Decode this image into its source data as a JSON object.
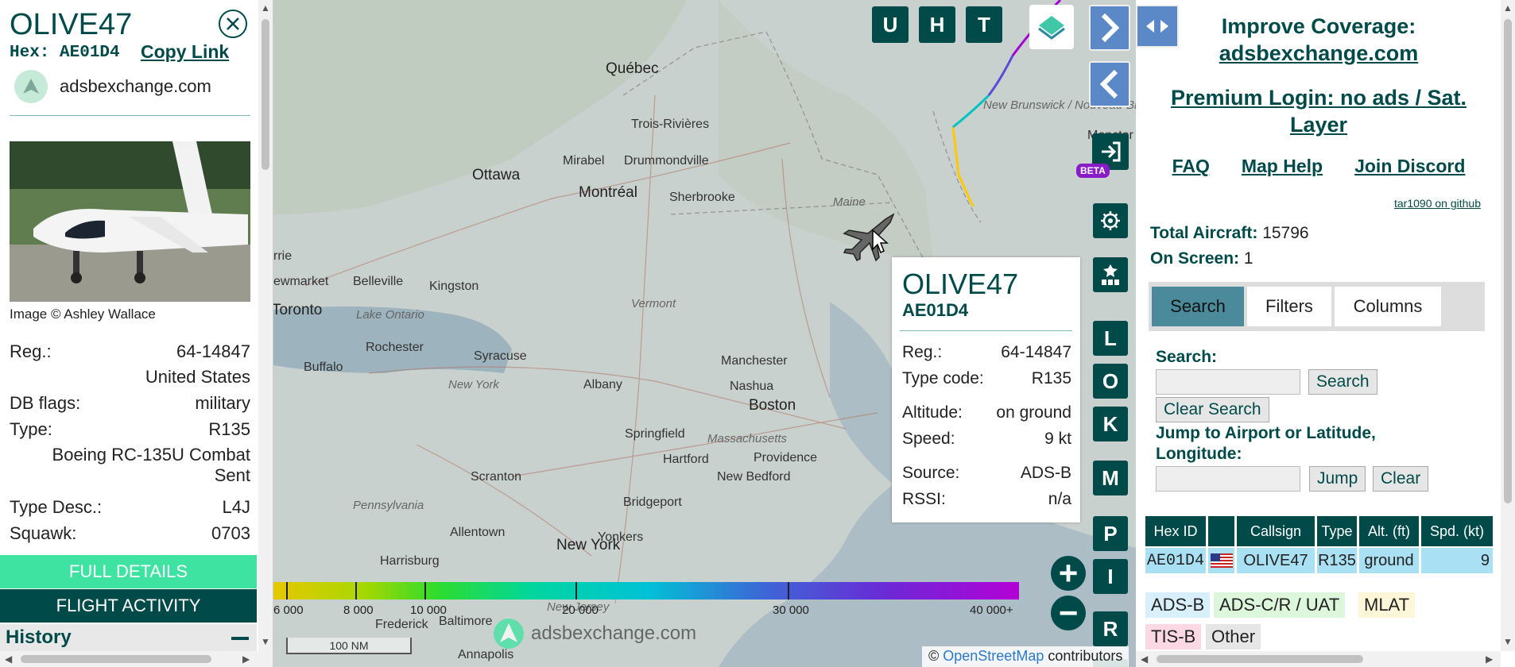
{
  "aircraft": {
    "callsign": "OLIVE47",
    "hex_line": "Hex: AE01D4",
    "hex": "AE01D4",
    "copy_link": "Copy Link",
    "source_site": "adsbexchange.com",
    "image_credit": "Image © Ashley Wallace",
    "details": [
      {
        "label": "Reg.:",
        "value": "64-14847"
      },
      {
        "label": "",
        "value": "United States"
      },
      {
        "label": "DB flags:",
        "value": "military"
      },
      {
        "label": "Type:",
        "value": "R135"
      },
      {
        "label": "",
        "value": "Boeing RC-135U Combat Sent"
      },
      {
        "label": "Type Desc.:",
        "value": "L4J"
      },
      {
        "label": "Squawk:",
        "value": "0703"
      }
    ],
    "full_details": "FULL DETAILS",
    "flight_activity": "FLIGHT ACTIVITY",
    "history": "History"
  },
  "map": {
    "labels": [
      "Québec",
      "Trois-Rivières",
      "Mirabel",
      "Drummondville",
      "Ottawa",
      "Montréal",
      "Sherbrooke",
      "Maine",
      "New Brunswick / Nouveau-Brunswick",
      "Belleville",
      "Kingston",
      "Toronto",
      "Lake Ontario",
      "Vermont",
      "Rochester",
      "Syracuse",
      "Buffalo",
      "New York",
      "Albany",
      "Manchester",
      "Nashua",
      "Boston",
      "Springfield",
      "Massachusetts",
      "Hartford",
      "Providence",
      "New Bedford",
      "Scranton",
      "Pennsylvania",
      "Yonkers",
      "Bridgeport",
      "Allentown",
      "New York",
      "Harrisburg",
      "Frederick",
      "Baltimore",
      "Annapolis",
      "New Jersey",
      "Monctor",
      "rrie",
      "ewmarket"
    ],
    "top_buttons": [
      "U",
      "H",
      "T"
    ],
    "side_buttons": [
      "L",
      "O",
      "K",
      "M",
      "P",
      "I",
      "R"
    ],
    "beta": "BETA",
    "legend_labels": [
      "6 000",
      "8 000",
      "10 000",
      "20 000",
      "30 000",
      "40 000+"
    ],
    "scale": "100 NM",
    "watermark": "adsbexchange.com",
    "attribution_prefix": "© ",
    "attribution_link": "OpenStreetMap",
    "attribution_suffix": " contributors",
    "zoom_in": "+",
    "zoom_out": "−"
  },
  "popup": {
    "callsign": "OLIVE47",
    "hex": "AE01D4",
    "rows": [
      {
        "label": "Reg.:",
        "value": "64-14847"
      },
      {
        "label": "Type code:",
        "value": "R135"
      },
      {
        "label": "Altitude:",
        "value": "on ground"
      },
      {
        "label": "Speed:",
        "value": "9 kt"
      },
      {
        "label": "Source:",
        "value": "ADS-B"
      },
      {
        "label": "RSSI:",
        "value": "n/a"
      }
    ]
  },
  "right": {
    "improve_1": "Improve Coverage:",
    "improve_2": "adsbexchange.com",
    "premium_1": "Premium Login: no ads / Sat.",
    "premium_2": "Layer",
    "links": [
      "FAQ",
      "Map Help",
      "Join Discord"
    ],
    "github": "tar1090 on github",
    "total_label": "Total Aircraft:",
    "total_value": "15796",
    "onscreen_label": "On Screen:",
    "onscreen_value": "1",
    "tabs": [
      "Search",
      "Filters",
      "Columns"
    ],
    "search_label": "Search:",
    "search_btn": "Search",
    "clear_search_btn": "Clear Search",
    "jump_label_1": "Jump to Airport or Latitude,",
    "jump_label_2": "Longitude:",
    "jump_btn": "Jump",
    "clear_btn": "Clear",
    "table_headers": [
      "Hex ID",
      "",
      "Callsign",
      "Type",
      "Alt. (ft)",
      "Spd. (kt)"
    ],
    "table_row": [
      "AE01D4",
      "",
      "OLIVE47",
      "R135",
      "ground",
      "9"
    ],
    "source_chips": [
      {
        "label": "ADS-B",
        "color": "#d8f0fb"
      },
      {
        "label": "ADS-C/R / UAT",
        "color": "#dcf7dc"
      },
      {
        "label": "MLAT",
        "color": "#fdf6d8"
      },
      {
        "label": "TIS-B",
        "color": "#fbd8e4"
      },
      {
        "label": "Other",
        "color": "#e6e6e6"
      }
    ]
  },
  "colors": {
    "accent": "#004a4a",
    "full_details": "#3ee3a1",
    "tab_active": "#4a8a9a",
    "row_highlight": "#a9e0f3"
  }
}
